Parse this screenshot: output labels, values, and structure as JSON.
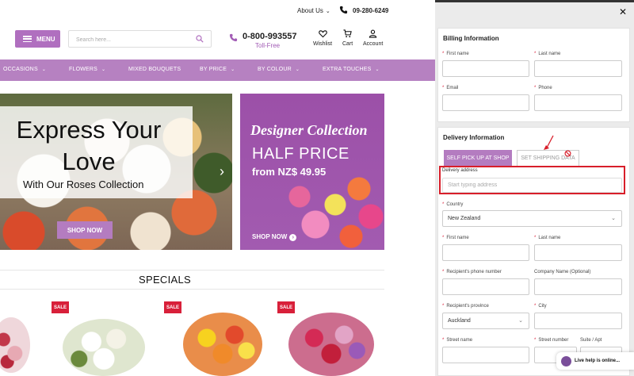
{
  "topbar": {
    "about_label": "About Us",
    "chevron": "⌄",
    "phone": "09-280-6249"
  },
  "header": {
    "menu_label": "MENU",
    "search_placeholder": "Search here...",
    "toll_number": "0-800-993557",
    "toll_label": "Toll-Free",
    "icons": [
      {
        "label": "Wishlist",
        "icon": "heart-icon"
      },
      {
        "label": "Cart",
        "icon": "cart-icon"
      },
      {
        "label": "Account",
        "icon": "user-icon"
      }
    ]
  },
  "nav": {
    "items": [
      "OCCASIONS",
      "FLOWERS",
      "MIXED BOUQUETS",
      "BY PRICE",
      "BY COLOUR",
      "EXTRA TOUCHES"
    ]
  },
  "hero": {
    "title_line1": "Express Your",
    "title_line2": "Love",
    "subtitle": "With Our Roses Collection",
    "cta": "SHOP NOW",
    "next_arrow": "›"
  },
  "promo": {
    "title": "Designer Collection",
    "headline": "HALF PRICE",
    "price": "from NZ$ 49.95",
    "cta": "SHOP NOW",
    "cta_icon": "›"
  },
  "specials": {
    "title": "SPECIALS",
    "badge": "SALE"
  },
  "panel": {
    "close": "✕",
    "billing": {
      "title": "Billing Information",
      "first_name": "First name",
      "last_name": "Last name",
      "email": "Email",
      "phone": "Phone"
    },
    "delivery": {
      "title": "Delivery Information",
      "tab_pickup": "SELF PICK UP AT SHOP",
      "tab_shipping": "SET SHIPPING DATA",
      "address_label": "Delivery address",
      "address_placeholder": "Start typing address",
      "country_label": "Country",
      "country_value": "New Zealand",
      "first_name": "First name",
      "last_name": "Last name",
      "recipient_phone": "Recipient's phone number",
      "company": "Company Name (Optional)",
      "province_label": "Recipient's province",
      "province_value": "Auckland",
      "city": "City",
      "street_name": "Street name",
      "street_number": "Street number",
      "suite": "Suite / Apt"
    },
    "required_mark": "*",
    "live_help": "Live help is online..."
  },
  "colors": {
    "accent": "#b47cc0",
    "nav": "#b681c1",
    "sale": "#d8203a",
    "highlight": "#d81e2a"
  }
}
